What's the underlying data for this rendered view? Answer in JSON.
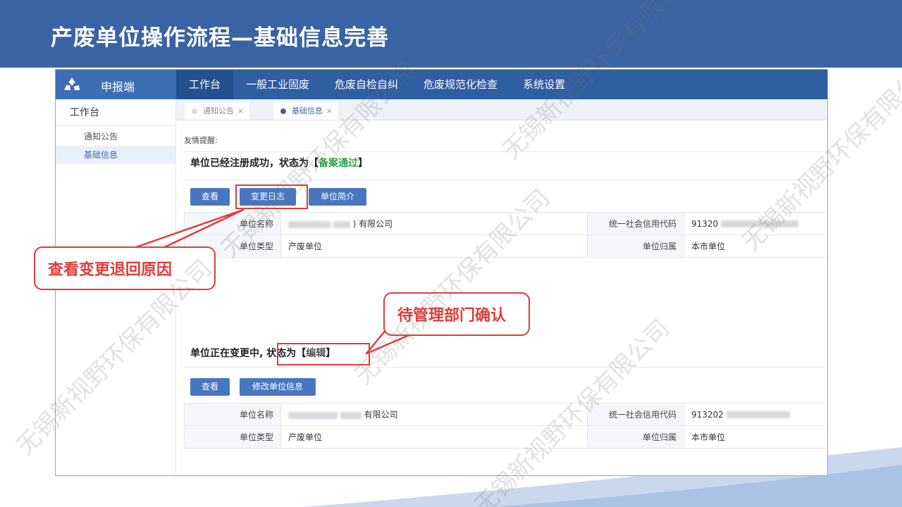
{
  "slide": {
    "title": "产废单位操作流程—基础信息完善"
  },
  "app": {
    "brand": "申报端",
    "nav": [
      "工作台",
      "一般工业固废",
      "危废自检自纠",
      "危废规范化检查",
      "系统设置"
    ],
    "sidebar": {
      "header": "工作台",
      "items": [
        "通知公告",
        "基础信息"
      ]
    },
    "tabs": [
      {
        "label": "通知公告",
        "close": "×"
      },
      {
        "label": "基础信息",
        "close": "×"
      }
    ]
  },
  "content": {
    "reminder": "友情提醒:",
    "section1": {
      "status_prefix": "单位已经注册成功，状态为【",
      "status_value": "备案通过",
      "status_suffix": "】",
      "buttons": [
        "查看",
        "变更日志",
        "单位简介"
      ],
      "rows": [
        {
          "label1": "单位名称",
          "value1": "有限公司",
          "value1_prefix": ")",
          "label2": "统一社会信用代码",
          "value2": "91320"
        },
        {
          "label1": "单位类型",
          "value1": "产废单位",
          "label2": "单位归属",
          "value2": "本市单位"
        }
      ]
    },
    "section2": {
      "status_prefix": "单位正在变更中,",
      "status_state": "状态为【",
      "status_value": "编辑",
      "status_suffix": "】",
      "buttons": [
        "查看",
        "修改单位信息"
      ],
      "rows": [
        {
          "label1": "单位名称",
          "value1": "有限公司",
          "label2": "统一社会信用代码",
          "value2": "913202"
        },
        {
          "label1": "单位类型",
          "value1": "产废单位",
          "label2": "单位归属",
          "value2": "本市单位"
        }
      ]
    }
  },
  "callouts": {
    "change_log": "查看变更退回原因",
    "pending": "待管理部门确认"
  },
  "watermark": "无锡新视野环保有限公司",
  "colors": {
    "header": "#3a63a3",
    "nav": "#2f5ea1",
    "accent_button": "#4a76bf",
    "callout_red": "#e03b3b",
    "status_green": "#2fa447"
  }
}
